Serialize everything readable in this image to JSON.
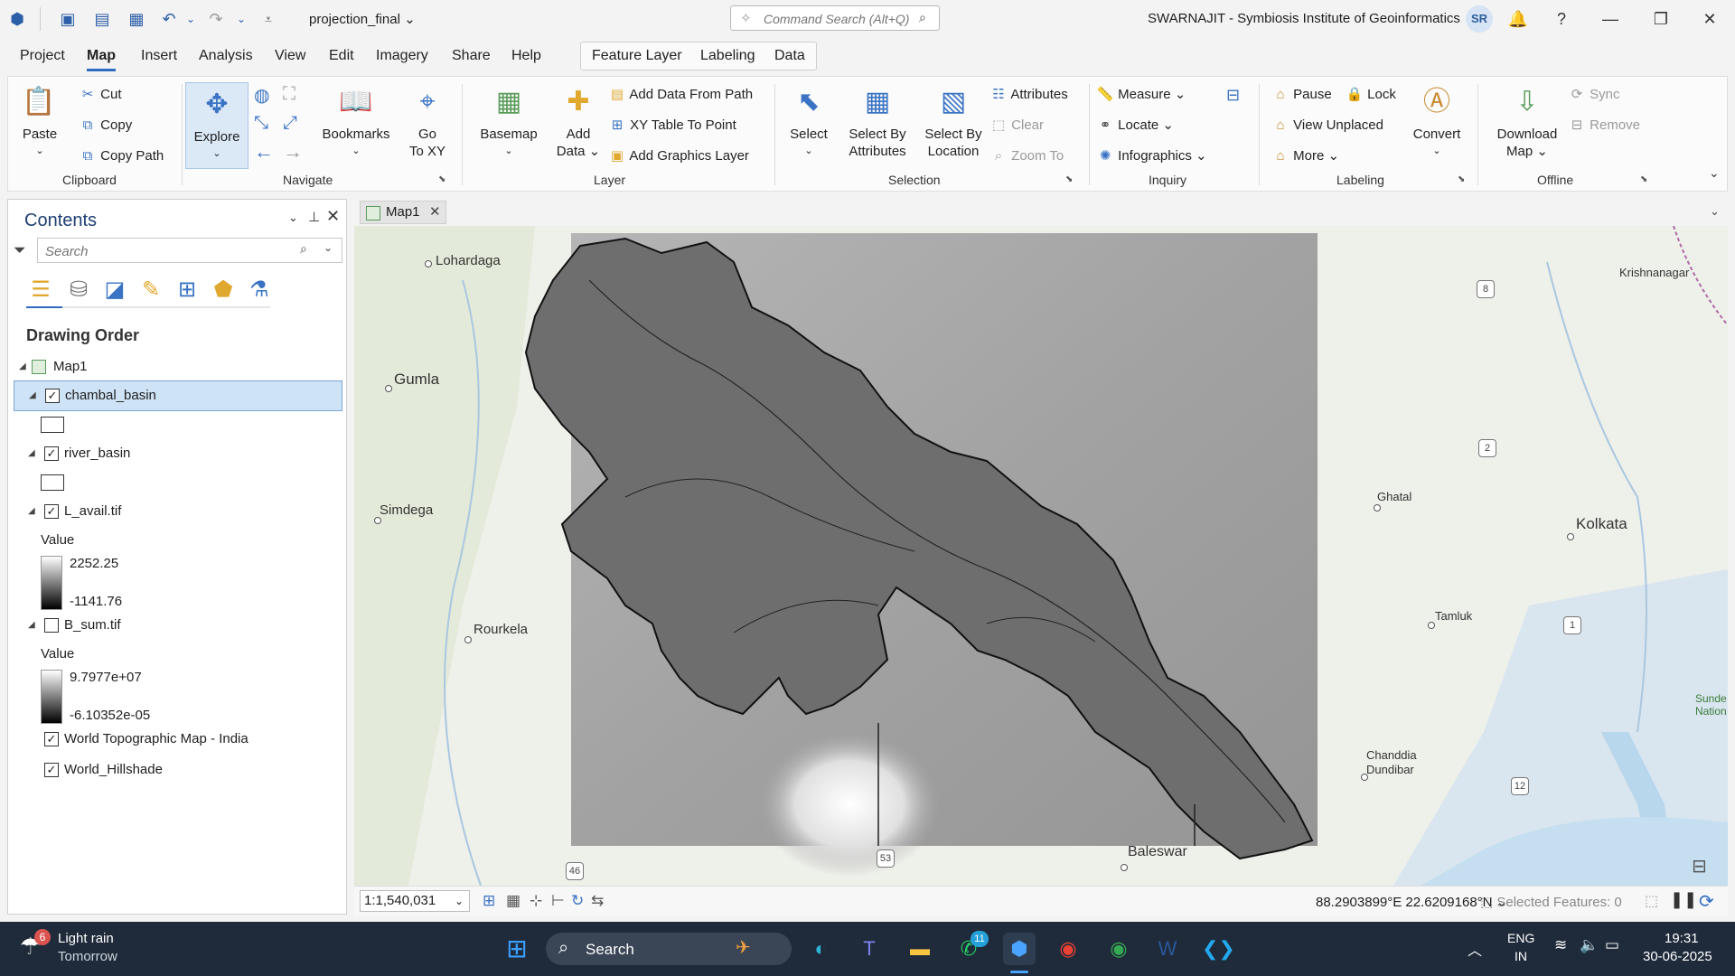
{
  "window": {
    "title_doc": "projection_final",
    "account": "SWARNAJIT - Symbiosis Institute of Geoinformatics",
    "avatar_initials": "SR"
  },
  "command_search": {
    "placeholder": "Command Search (Alt+Q)"
  },
  "menu": {
    "tabs": [
      "Project",
      "Map",
      "Insert",
      "Analysis",
      "View",
      "Edit",
      "Imagery",
      "Share",
      "Help"
    ],
    "active": "Map",
    "contextual_tabs": [
      "Feature Layer",
      "Labeling",
      "Data"
    ]
  },
  "ribbon": {
    "clipboard": {
      "paste": "Paste",
      "cut": "Cut",
      "copy": "Copy",
      "copy_path": "Copy Path",
      "group": "Clipboard"
    },
    "navigate": {
      "explore": "Explore",
      "bookmarks": "Bookmarks",
      "go_to_xy_1": "Go",
      "go_to_xy_2": "To XY",
      "group": "Navigate"
    },
    "layer": {
      "basemap": "Basemap",
      "add_data_1": "Add",
      "add_data_2": "Data",
      "add_data_from_path": "Add Data From Path",
      "xy_table_to_point": "XY Table To Point",
      "add_graphics_layer": "Add Graphics Layer",
      "group": "Layer"
    },
    "selection": {
      "select": "Select",
      "select_by_attr_1": "Select By",
      "select_by_attr_2": "Attributes",
      "select_by_loc_1": "Select By",
      "select_by_loc_2": "Location",
      "attributes": "Attributes",
      "clear": "Clear",
      "zoom_to": "Zoom To",
      "group": "Selection"
    },
    "inquiry": {
      "measure": "Measure",
      "locate": "Locate",
      "infographics": "Infographics",
      "group": "Inquiry"
    },
    "labeling": {
      "pause": "Pause",
      "lock": "Lock",
      "view_unplaced": "View Unplaced",
      "more": "More",
      "convert": "Convert",
      "group": "Labeling"
    },
    "offline": {
      "download_map_1": "Download",
      "download_map_2": "Map",
      "sync": "Sync",
      "remove": "Remove",
      "group": "Offline"
    }
  },
  "contents": {
    "title": "Contents",
    "search_placeholder": "Search",
    "drawing_order": "Drawing Order",
    "map_name": "Map1",
    "layers": [
      {
        "name": "chambal_basin",
        "checked": true,
        "selected": true
      },
      {
        "name": "river_basin",
        "checked": true
      },
      {
        "name": "L_avail.tif",
        "checked": true,
        "value_label": "Value",
        "high": "2252.25",
        "low": "-1141.76"
      },
      {
        "name": "B_sum.tif",
        "checked": false,
        "value_label": "Value",
        "high": "9.7977e+07",
        "low": "-6.10352e-05"
      },
      {
        "name": "World Topographic Map - India",
        "checked": true
      },
      {
        "name": "World_Hillshade",
        "checked": true
      }
    ]
  },
  "map_view": {
    "tab_label": "Map1",
    "places": {
      "lohardaga": "Lohardaga",
      "gumla": "Gumla",
      "simdega": "Simdega",
      "rourkela": "Rourkela",
      "krishnanagar": "Krishnanagar",
      "ghatal": "Ghatal",
      "kolkata": "Kolkata",
      "tamluk": "Tamluk",
      "chanddia_1": "Chanddia",
      "chanddia_2": "Dundibar",
      "baleswar": "Baleswar",
      "sunde_1": "Sunde",
      "sunde_2": "Nation"
    },
    "road_shields": [
      "8",
      "2",
      "1",
      "12",
      "53",
      "46"
    ]
  },
  "status": {
    "scale": "1:1,540,031",
    "coordinates": "88.2903899°E 22.6209168°N",
    "selected_features": "Selected Features: 0"
  },
  "taskbar": {
    "weather_1": "Light rain",
    "weather_2": "Tomorrow",
    "weather_badge": "6",
    "search": "Search",
    "whatsapp_badge": "11",
    "lang_1": "ENG",
    "lang_2": "IN",
    "time": "19:31",
    "date": "30-06-2025"
  },
  "colors": {
    "accent": "#2f6bc1",
    "taskbar": "#1f2b3a",
    "selection": "#cfe3f6"
  }
}
